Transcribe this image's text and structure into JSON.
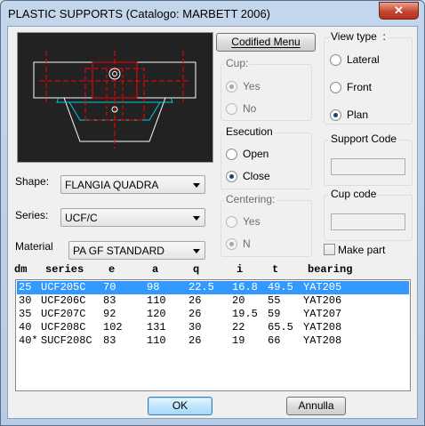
{
  "window": {
    "title": "PLASTIC SUPPORTS (Catalogo: MARBETT 2006)",
    "close_glyph": "✕"
  },
  "colors": {
    "selection": "#3399ff",
    "drawing_background": "#222222",
    "drawing_white": "#ffffff",
    "drawing_red": "#ff0000",
    "drawing_cyan": "#00d0d8"
  },
  "buttons": {
    "codified_menu": "Codified Menu",
    "ok": "OK",
    "annulla": "Annulla"
  },
  "fields": {
    "shape": {
      "label": "Shape:",
      "value": "FLANGIA QUADRA"
    },
    "series": {
      "label": "Series:",
      "value": "UCF/C"
    },
    "material": {
      "label": "Material",
      "value": "PA GF STANDARD"
    }
  },
  "cup": {
    "label": "Cup:",
    "options": [
      {
        "label": "Yes",
        "selected": true,
        "enabled": false
      },
      {
        "label": "No",
        "selected": false,
        "enabled": false
      }
    ]
  },
  "esecution": {
    "label": "Esecution",
    "options": [
      {
        "label": "Open",
        "selected": false,
        "enabled": true
      },
      {
        "label": "Close",
        "selected": true,
        "enabled": true
      }
    ]
  },
  "centering": {
    "label": "Centering:",
    "options": [
      {
        "label": "Yes",
        "selected": false,
        "enabled": false
      },
      {
        "label": "N",
        "selected": true,
        "enabled": false
      }
    ]
  },
  "view_type": {
    "label": "View type  :",
    "options": [
      {
        "label": "Lateral",
        "selected": false,
        "enabled": true
      },
      {
        "label": "Front",
        "selected": false,
        "enabled": true
      },
      {
        "label": "Plan",
        "selected": true,
        "enabled": true
      }
    ]
  },
  "support_code": {
    "label": "Support Code",
    "value": ""
  },
  "cup_code": {
    "label": "Cup code",
    "value": ""
  },
  "make_part": {
    "label": "Make part",
    "checked": false
  },
  "table": {
    "columns": [
      "dm",
      "series",
      "e",
      "a",
      "q",
      "i",
      "t",
      "bearing"
    ],
    "rows": [
      [
        "25",
        "UCF205C",
        "70",
        "98",
        "22.5",
        "16.8",
        "49.5",
        "YAT205"
      ],
      [
        "30",
        "UCF206C",
        "83",
        "110",
        "26",
        "20",
        "55",
        "YAT206"
      ],
      [
        "35",
        "UCF207C",
        "92",
        "120",
        "26",
        "19.5",
        "59",
        "YAT207"
      ],
      [
        "40",
        "UCF208C",
        "102",
        "131",
        "30",
        "22",
        "65.5",
        "YAT208"
      ],
      [
        "40*",
        "SUCF208C",
        "83",
        "110",
        "26",
        "19",
        "66",
        "YAT208"
      ]
    ],
    "selected_row": 0
  }
}
